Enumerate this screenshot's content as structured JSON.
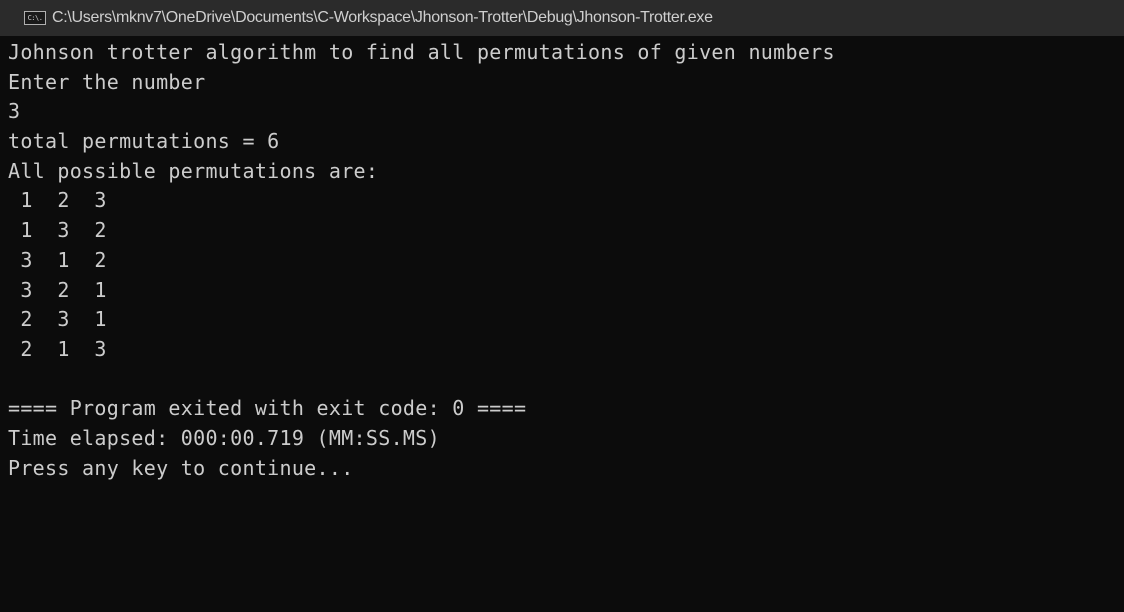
{
  "window": {
    "title": "C:\\Users\\mknv7\\OneDrive\\Documents\\C-Workspace\\Jhonson-Trotter\\Debug\\Jhonson-Trotter.exe",
    "icon": "console-app-icon",
    "icon_glyph": "C:\\."
  },
  "console": {
    "lines": [
      "Johnson trotter algorithm to find all permutations of given numbers",
      "Enter the number",
      "3",
      "total permutations = 6",
      "All possible permutations are:",
      " 1  2  3",
      " 1  3  2",
      " 3  1  2",
      " 3  2  1",
      " 2  3  1",
      " 2  1  3",
      "",
      "==== Program exited with exit code: 0 ====",
      "Time elapsed: 000:00.719 (MM:SS.MS)",
      "Press any key to continue..."
    ]
  },
  "colors": {
    "background": "#0c0c0c",
    "text": "#cccccc",
    "titlebar": "#2b2b2b"
  }
}
